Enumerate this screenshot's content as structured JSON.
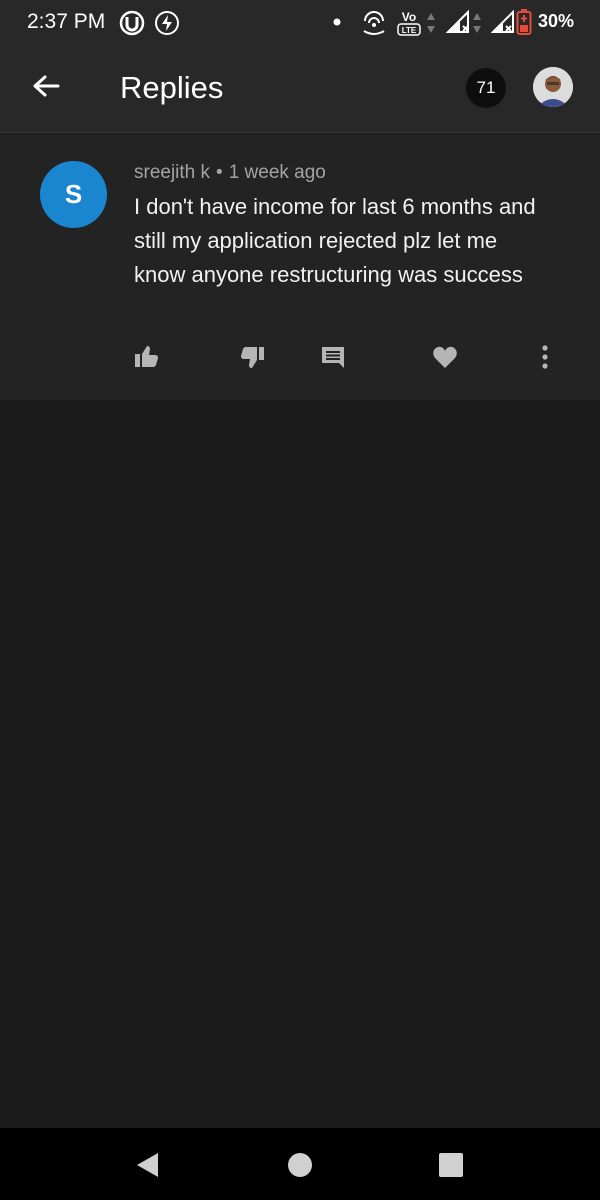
{
  "status_bar": {
    "time": "2:37 PM",
    "battery": "30%",
    "icons": [
      "utorrent-icon",
      "data-saver-icon",
      "notification-dot-icon",
      "hotspot-icon",
      "volte-icon",
      "signal-icon",
      "signal-icon",
      "battery-icon"
    ],
    "volte_label": "Vo",
    "lte_label": "LTE"
  },
  "header": {
    "title": "Replies",
    "reply_count": "71"
  },
  "comment": {
    "avatar_letter": "S",
    "avatar_color": "#1a86d0",
    "author": "sreejith k",
    "separator": "•",
    "time": "1 week ago",
    "text": "I don't have income for last 6 months and still my application rejected plz let me know anyone restructuring was success",
    "actions": [
      "thumbs-up-icon",
      "thumbs-down-icon",
      "reply-icon",
      "heart-icon",
      "more-vertical-icon"
    ]
  },
  "nav_bar": {
    "buttons": [
      "back-triangle-icon",
      "home-circle-icon",
      "recents-square-icon"
    ]
  }
}
